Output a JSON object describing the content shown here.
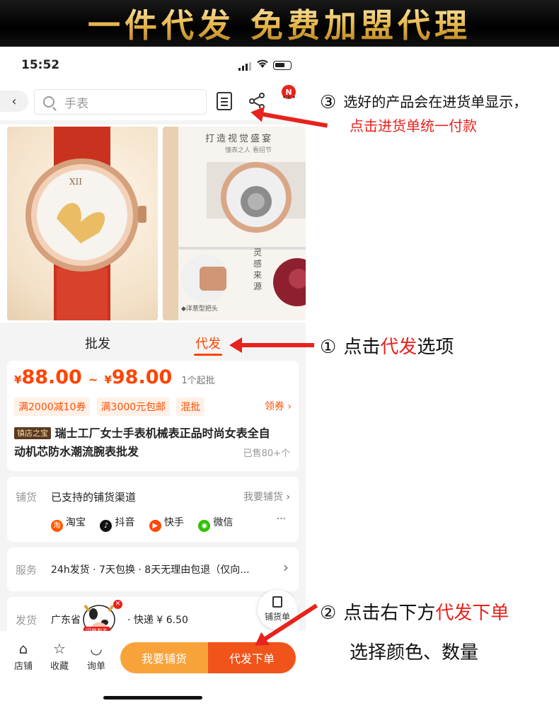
{
  "banner": {
    "title": "一件代发 免费加盟代理"
  },
  "status_bar": {
    "time": "15:52"
  },
  "nav": {
    "search_placeholder": "手表",
    "badge": "N"
  },
  "gallery": {
    "img2_heading": "打造视觉盛宴",
    "img2_sub": "懂表之人 看招节",
    "img2_vertical": "灵感来源",
    "img2_caption": "◆洋葱型把头"
  },
  "tabs": {
    "wholesale": "批发",
    "dropship": "代发"
  },
  "price": {
    "currency": "¥",
    "low": "88.00",
    "sep": "~",
    "high": "98.00",
    "min_order": "1个起批",
    "tags": [
      "满2000减10券",
      "满3000元包邮",
      "混批"
    ],
    "coupon_link": "领券"
  },
  "product": {
    "badge": "镇店之宝",
    "title_line1": "瑞士工厂女士手表机械表正品时尚女表全自",
    "title_line2": "动机芯防水潮流腕表批发",
    "sold": "已售80+个"
  },
  "distribution": {
    "label": "铺货",
    "text": "已支持的铺货渠道",
    "link": "我要铺货",
    "channels": [
      "淘宝",
      "抖音",
      "快手",
      "微信"
    ],
    "more": "···"
  },
  "service": {
    "label": "服务",
    "text": "24h发货 · 7天包换 · 8天无理由包退（仅向..."
  },
  "shipping": {
    "label": "发货",
    "from": "广东省 深圳市",
    "express": "· 快递 ¥ 6.50",
    "float_label": "铺货单",
    "mascot_label": "闪单有礼"
  },
  "bottom_bar": {
    "shop": "店铺",
    "favorite": "收藏",
    "inquiry": "询单",
    "distribute_btn": "我要铺货",
    "dropship_btn": "代发下单"
  },
  "annotations": {
    "a3_num": "③",
    "a3_line1": "选好的产品会在进货单显示，",
    "a3_line2": "点击进货单统一付款",
    "a1_num": "①",
    "a1_pre": "点击",
    "a1_red": "代发",
    "a1_post": "选项",
    "a2_num": "②",
    "a2_pre": "点击右下方",
    "a2_red": "代发下单",
    "a2_line2": "选择颜色、数量"
  },
  "colors": {
    "accent": "#ff4400",
    "annotation_red": "#e8221c",
    "button_orange": "#f7a33a",
    "button_red": "#f1541a"
  }
}
